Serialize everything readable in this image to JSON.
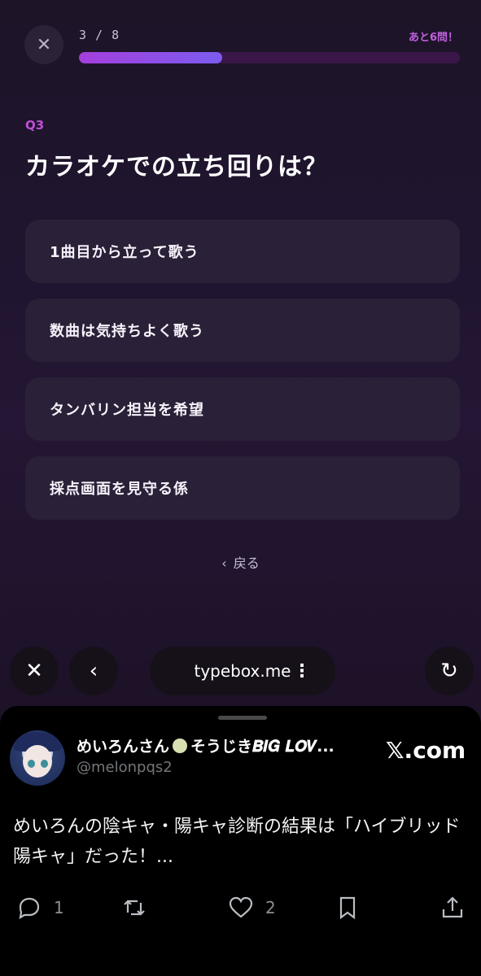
{
  "quiz": {
    "progress_text": "3 / 8",
    "progress_fraction": 0.375,
    "remaining_text": "あと6問！",
    "question_number": "Q3",
    "question": "カラオケでの立ち回りは？",
    "options": [
      "1曲目から立って歌う",
      "数曲は気持ちよく歌う",
      "タンバリン担当を希望",
      "採点画面を見守る係"
    ],
    "back_label": "戻る"
  },
  "browser": {
    "url": "typebox.me"
  },
  "tweet": {
    "display_name": "めいろんさん",
    "display_name_suffix": "そうじき𝑩𝑰𝑮 𝑳𝑶𝑽...",
    "handle": "@melonpqs2",
    "source": "𝕏.com",
    "text": "めいろんの陰キャ・陽キャ診断の結果は「ハイブリッド陽キャ」だった！...",
    "reply_count": "1",
    "like_count": "2"
  },
  "colors": {
    "accent": "#a43fdc",
    "remaining": "#c262e0"
  }
}
